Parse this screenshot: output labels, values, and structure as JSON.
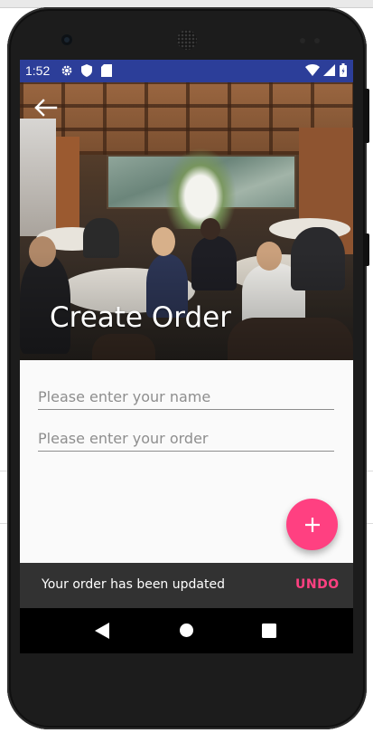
{
  "status_bar": {
    "time": "1:52",
    "icons": [
      "gear-icon",
      "shield-icon",
      "sd-card-icon",
      "wifi-icon",
      "signal-icon",
      "battery-icon"
    ]
  },
  "toolbar": {
    "title": "Create Order",
    "back_icon": "arrow-back-icon"
  },
  "form": {
    "name_placeholder": "Please enter your name",
    "name_value": "",
    "order_placeholder": "Please enter your order",
    "order_value": ""
  },
  "fab": {
    "icon": "plus-icon",
    "color": "#ff4081"
  },
  "snackbar": {
    "message": "Your order has been updated",
    "action": "UNDO",
    "action_color": "#ff4081"
  },
  "nav_bar": {
    "buttons": [
      "back-triangle-icon",
      "home-circle-icon",
      "recents-square-icon"
    ]
  },
  "colors": {
    "status_bar": "#2c3e99",
    "accent": "#ff4081",
    "snackbar_bg": "#323232"
  }
}
